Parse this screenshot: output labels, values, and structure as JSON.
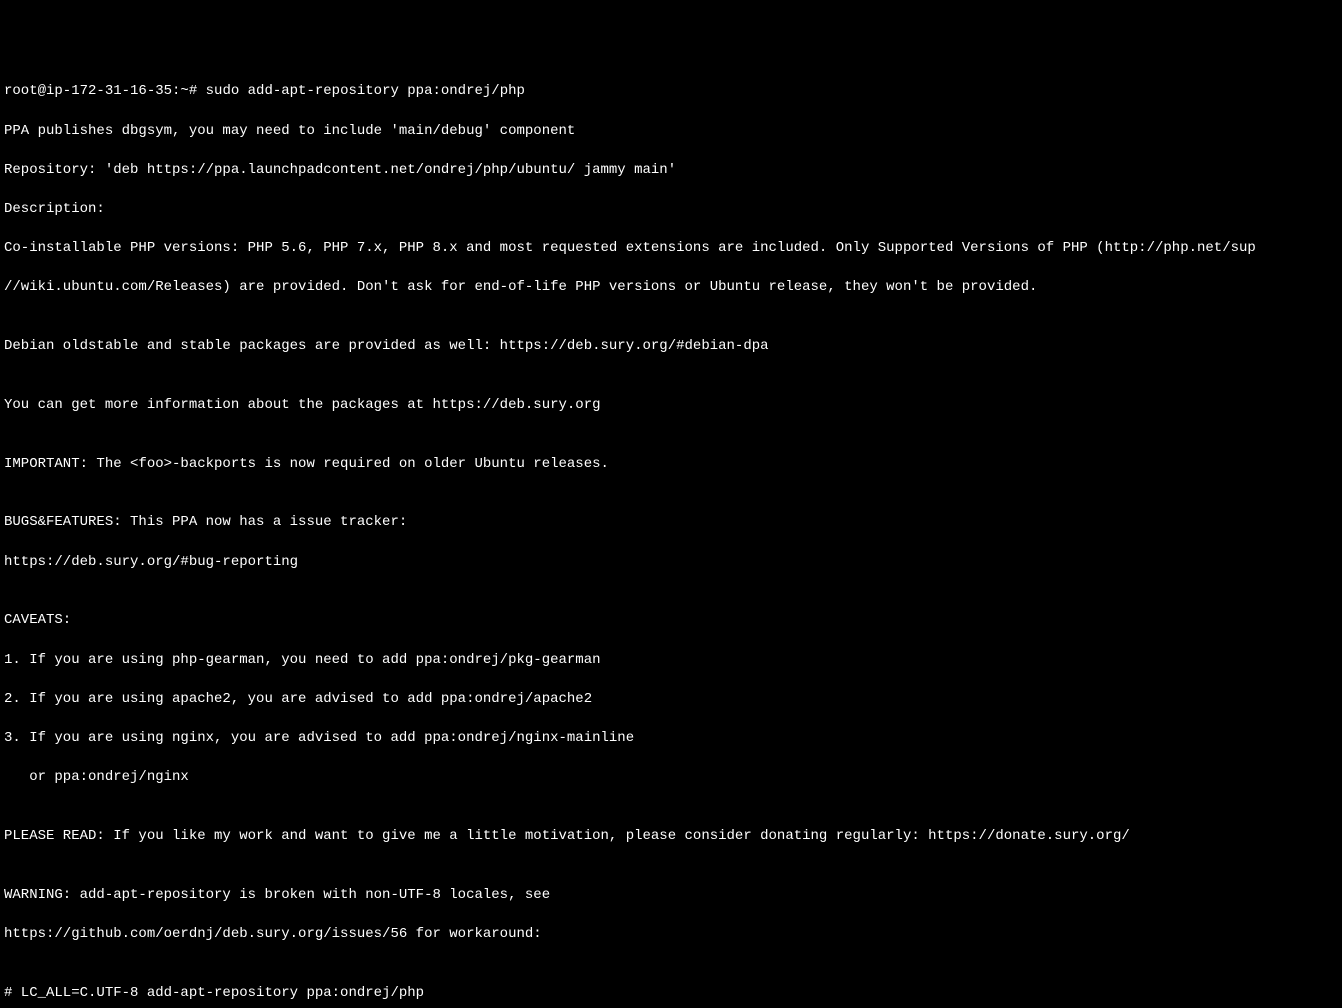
{
  "terminal": {
    "prompt1": "root@ip-172-31-16-35:~# ",
    "command1": "sudo add-apt-repository ppa:ondrej/php",
    "line2": "PPA publishes dbgsym, you may need to include 'main/debug' component",
    "line3": "Repository: 'deb https://ppa.launchpadcontent.net/ondrej/php/ubuntu/ jammy main'",
    "line4": "Description:",
    "line5": "Co-installable PHP versions: PHP 5.6, PHP 7.x, PHP 8.x and most requested extensions are included. Only Supported Versions of PHP (http://php.net/sup",
    "line6": "//wiki.ubuntu.com/Releases) are provided. Don't ask for end-of-life PHP versions or Ubuntu release, they won't be provided.",
    "line7": "",
    "line8": "Debian oldstable and stable packages are provided as well: https://deb.sury.org/#debian-dpa",
    "line9": "",
    "line10": "You can get more information about the packages at https://deb.sury.org",
    "line11": "",
    "line12": "IMPORTANT: The <foo>-backports is now required on older Ubuntu releases.",
    "line13": "",
    "line14": "BUGS&FEATURES: This PPA now has a issue tracker:",
    "line15": "https://deb.sury.org/#bug-reporting",
    "line16": "",
    "line17": "CAVEATS:",
    "line18": "1. If you are using php-gearman, you need to add ppa:ondrej/pkg-gearman",
    "line19": "2. If you are using apache2, you are advised to add ppa:ondrej/apache2",
    "line20": "3. If you are using nginx, you are advised to add ppa:ondrej/nginx-mainline",
    "line21": "   or ppa:ondrej/nginx",
    "line22": "",
    "line23": "PLEASE READ: If you like my work and want to give me a little motivation, please consider donating regularly: https://donate.sury.org/",
    "line24": "",
    "line25": "WARNING: add-apt-repository is broken with non-UTF-8 locales, see",
    "line26": "https://github.com/oerdnj/deb.sury.org/issues/56 for workaround:",
    "line27": "",
    "line28": "# LC_ALL=C.UTF-8 add-apt-repository ppa:ondrej/php"
  }
}
